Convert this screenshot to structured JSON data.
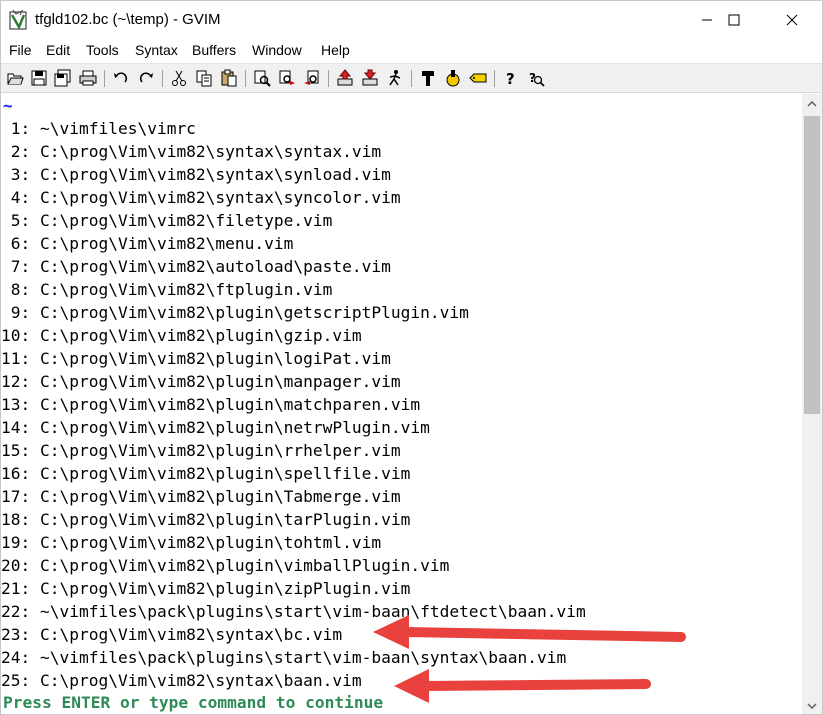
{
  "window": {
    "title": "tfgld102.bc (~\\temp) - GVIM",
    "controls": [
      "minimize",
      "maximize",
      "close"
    ]
  },
  "menu": {
    "items": [
      "File",
      "Edit",
      "Tools",
      "Syntax",
      "Buffers",
      "Window",
      "Help"
    ]
  },
  "toolbar": {
    "icons": [
      "open-icon",
      "save-icon",
      "save-all-icon",
      "print-icon",
      "undo-icon",
      "redo-icon",
      "cut-icon",
      "copy-icon",
      "paste-icon",
      "find-replace-icon",
      "find-next-icon",
      "find-prev-icon",
      "load-session-icon",
      "save-session-icon",
      "run-script-icon",
      "make-icon",
      "shell-icon",
      "tags-icon",
      "help-icon",
      "find-help-icon"
    ]
  },
  "editor": {
    "tilde": "~",
    "lines": [
      {
        "num": " 1:",
        "path": "~\\vimfiles\\vimrc"
      },
      {
        "num": " 2:",
        "path": "C:\\prog\\Vim\\vim82\\syntax\\syntax.vim"
      },
      {
        "num": " 3:",
        "path": "C:\\prog\\Vim\\vim82\\syntax\\synload.vim"
      },
      {
        "num": " 4:",
        "path": "C:\\prog\\Vim\\vim82\\syntax\\syncolor.vim"
      },
      {
        "num": " 5:",
        "path": "C:\\prog\\Vim\\vim82\\filetype.vim"
      },
      {
        "num": " 6:",
        "path": "C:\\prog\\Vim\\vim82\\menu.vim"
      },
      {
        "num": " 7:",
        "path": "C:\\prog\\Vim\\vim82\\autoload\\paste.vim"
      },
      {
        "num": " 8:",
        "path": "C:\\prog\\Vim\\vim82\\ftplugin.vim"
      },
      {
        "num": " 9:",
        "path": "C:\\prog\\Vim\\vim82\\plugin\\getscriptPlugin.vim"
      },
      {
        "num": "10:",
        "path": "C:\\prog\\Vim\\vim82\\plugin\\gzip.vim"
      },
      {
        "num": "11:",
        "path": "C:\\prog\\Vim\\vim82\\plugin\\logiPat.vim"
      },
      {
        "num": "12:",
        "path": "C:\\prog\\Vim\\vim82\\plugin\\manpager.vim"
      },
      {
        "num": "13:",
        "path": "C:\\prog\\Vim\\vim82\\plugin\\matchparen.vim"
      },
      {
        "num": "14:",
        "path": "C:\\prog\\Vim\\vim82\\plugin\\netrwPlugin.vim"
      },
      {
        "num": "15:",
        "path": "C:\\prog\\Vim\\vim82\\plugin\\rrhelper.vim"
      },
      {
        "num": "16:",
        "path": "C:\\prog\\Vim\\vim82\\plugin\\spellfile.vim"
      },
      {
        "num": "17:",
        "path": "C:\\prog\\Vim\\vim82\\plugin\\Tabmerge.vim"
      },
      {
        "num": "18:",
        "path": "C:\\prog\\Vim\\vim82\\plugin\\tarPlugin.vim"
      },
      {
        "num": "19:",
        "path": "C:\\prog\\Vim\\vim82\\plugin\\tohtml.vim"
      },
      {
        "num": "20:",
        "path": "C:\\prog\\Vim\\vim82\\plugin\\vimballPlugin.vim"
      },
      {
        "num": "21:",
        "path": "C:\\prog\\Vim\\vim82\\plugin\\zipPlugin.vim"
      },
      {
        "num": "22:",
        "path": "~\\vimfiles\\pack\\plugins\\start\\vim-baan\\ftdetect\\baan.vim"
      },
      {
        "num": "23:",
        "path": "C:\\prog\\Vim\\vim82\\syntax\\bc.vim"
      },
      {
        "num": "24:",
        "path": "~\\vimfiles\\pack\\plugins\\start\\vim-baan\\syntax\\baan.vim"
      },
      {
        "num": "25:",
        "path": "C:\\prog\\Vim\\vim82\\syntax\\baan.vim"
      }
    ],
    "prompt": "Press ENTER or type command to continue"
  },
  "colors": {
    "tilde": "#1a1aff",
    "prompt": "#2e8b57",
    "annotation_arrow": "#e8413e"
  }
}
